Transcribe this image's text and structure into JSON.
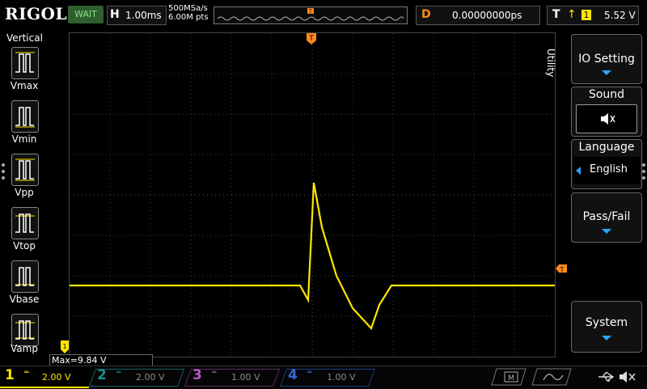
{
  "brand": "RIGOL",
  "status": "WAIT",
  "timebase": {
    "key": "H",
    "value": "1.00ms"
  },
  "acquisition": {
    "rate": "500MSa/s",
    "points": "6.00M pts"
  },
  "delay": {
    "key": "D",
    "value": "0.00000000ps"
  },
  "trigger": {
    "key": "T",
    "channel": "1",
    "level": "5.52 V"
  },
  "left_menu": {
    "title": "Vertical",
    "items": [
      "Vmax",
      "Vmin",
      "Vpp",
      "Vtop",
      "Vbase",
      "Vamp"
    ]
  },
  "right_menu": {
    "title": "Utility",
    "io_setting": "IO Setting",
    "sound": "Sound",
    "language": "Language",
    "language_value": "English",
    "pass_fail": "Pass/Fail",
    "system": "System"
  },
  "measurement": "Max=9.84 V",
  "channels": [
    {
      "num": "1",
      "scale": "2.00 V",
      "color": "#ffe600"
    },
    {
      "num": "2",
      "scale": "2.00 V",
      "color": "#1b8f8f"
    },
    {
      "num": "3",
      "scale": "1.00 V",
      "color": "#b05fc0"
    },
    {
      "num": "4",
      "scale": "1.00 V",
      "color": "#2f6bd8"
    }
  ],
  "colors": {
    "trace": "#ffe600",
    "trigger_marker": "#ff8a1c",
    "accent": "#2aa8ff"
  }
}
